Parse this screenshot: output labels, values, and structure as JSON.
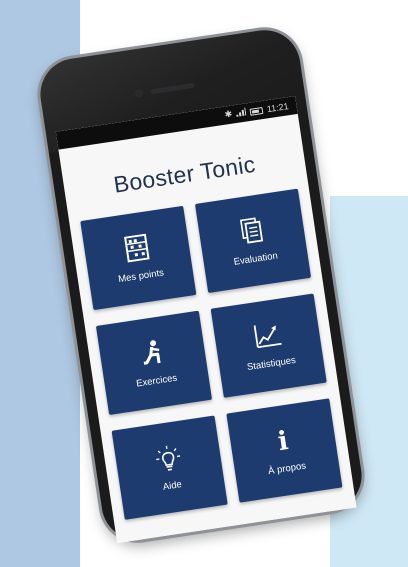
{
  "status_bar": {
    "time": "11:21",
    "icons": [
      "bluetooth-icon",
      "signal-icon",
      "battery-icon"
    ]
  },
  "app": {
    "title": "Booster Tonic"
  },
  "tiles": [
    {
      "label": "Mes points",
      "icon": "abacus-icon"
    },
    {
      "label": "Evaluation",
      "icon": "document-icon"
    },
    {
      "label": "Exercices",
      "icon": "exercise-icon"
    },
    {
      "label": "Statistiques",
      "icon": "chart-icon"
    },
    {
      "label": "Aide",
      "icon": "lightbulb-icon"
    },
    {
      "label": "À propos",
      "icon": "info-icon"
    }
  ],
  "colors": {
    "tile_background": "#1d3b6f",
    "title": "#23324f",
    "screen_background": "#f7f7f8",
    "left_panel": "#aec7e2",
    "right_panel": "#cfe8f5"
  }
}
